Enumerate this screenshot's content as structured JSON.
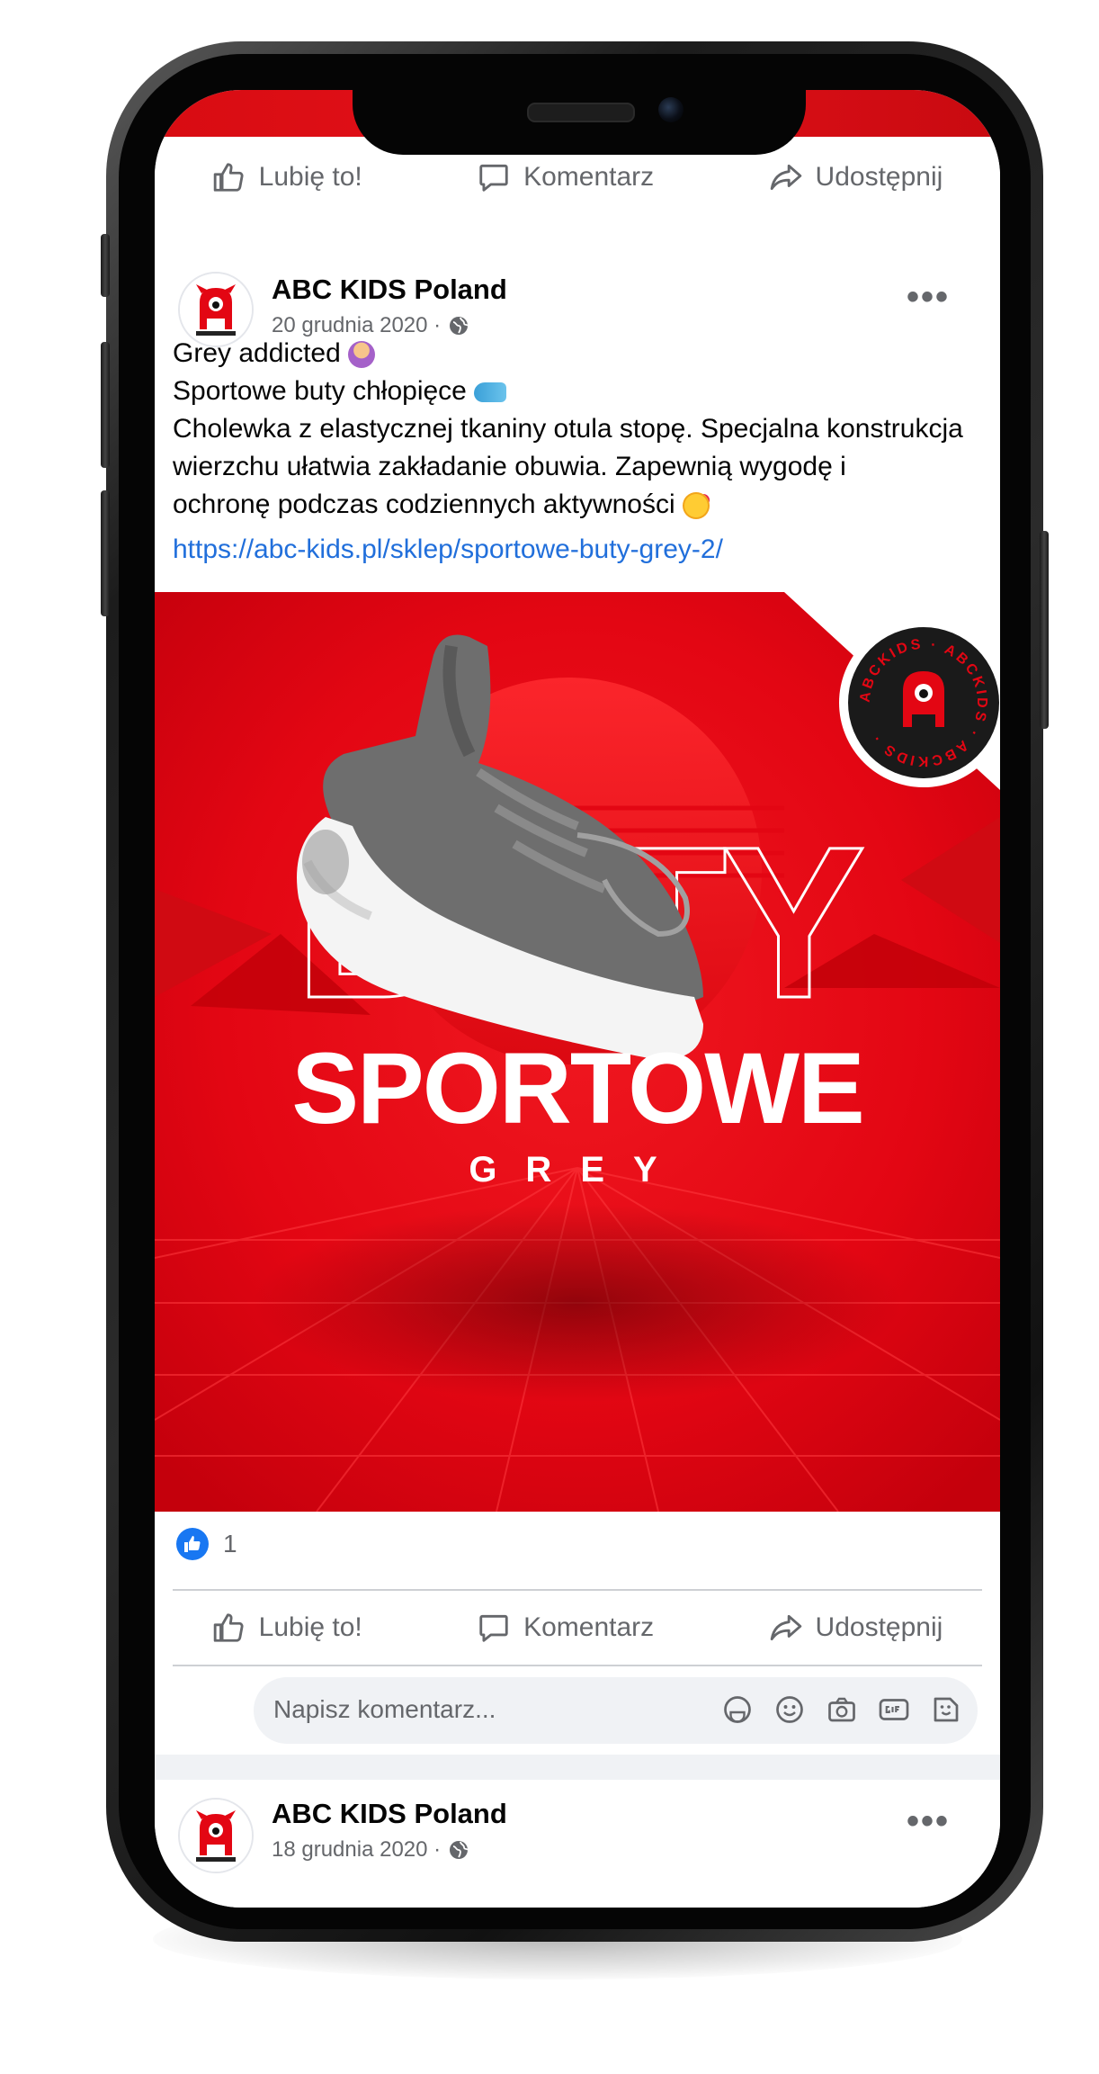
{
  "top_actions": {
    "like": "Lubię to!",
    "comment": "Komentarz",
    "share": "Udostępnij"
  },
  "post": {
    "author": "ABC KIDS Poland",
    "date": "20 grudnia 2020 ·",
    "more": "•••",
    "lines": [
      "Grey addicted",
      "Sportowe buty chłopięce",
      "Cholewka z elastycznej tkaniny otula stopę. Specjalna konstrukcja",
      "wierzchu ułatwia zakładanie obuwia. Zapewnią wygodę i",
      "ochronę podczas codziennych aktywności"
    ],
    "link": "https://abc-kids.pl/sklep/sportowe-buty-grey-2/",
    "image": {
      "headline_outline": "BUTY",
      "headline_solid": "SPORTOWE",
      "subline": "G R E Y",
      "badge_text": "ABCKIDS · ABCKIDS · ABCKIDS ·",
      "brand_mark": "ABCKIDS",
      "colors": {
        "primary": "#e30613",
        "dark": "#b3000b",
        "shoe": "#707070",
        "sole": "#ffffff"
      }
    },
    "reactions_count": "1",
    "actions": {
      "like": "Lubię to!",
      "comment": "Komentarz",
      "share": "Udostępnij"
    },
    "comment_placeholder": "Napisz komentarz..."
  },
  "next_post": {
    "author": "ABC KIDS Poland",
    "date": "18 grudnia 2020 ·",
    "more": "•••"
  },
  "icons": [
    "like-icon",
    "comment-icon",
    "share-icon",
    "globe-icon",
    "more-icon",
    "reaction-like-icon",
    "emoji-icon",
    "camera-icon",
    "gif-icon",
    "sticker-icon",
    "avatar-icon"
  ],
  "colors": {
    "fb_blue": "#1877f2",
    "link": "#216fdb",
    "text": "#050505",
    "muted": "#65676b",
    "bg": "#f0f2f5"
  }
}
